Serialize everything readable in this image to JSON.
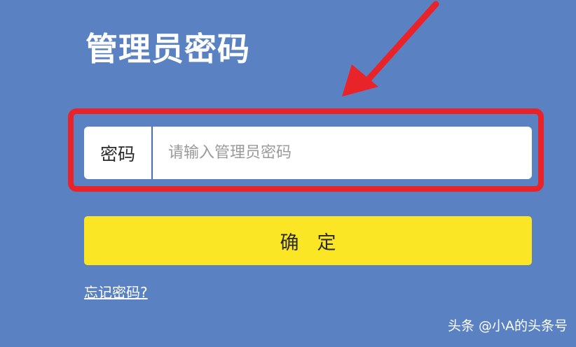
{
  "page": {
    "title": "管理员密码"
  },
  "password_field": {
    "label": "密码",
    "placeholder": "请输入管理员密码",
    "value": ""
  },
  "confirm_button": {
    "label": "确定"
  },
  "forgot_link": {
    "label": "忘记密码?"
  },
  "watermark": {
    "text": "头条 @小A的头条号"
  },
  "colors": {
    "background": "#5a82c2",
    "button": "#fbe625",
    "highlight": "#e8242a"
  }
}
